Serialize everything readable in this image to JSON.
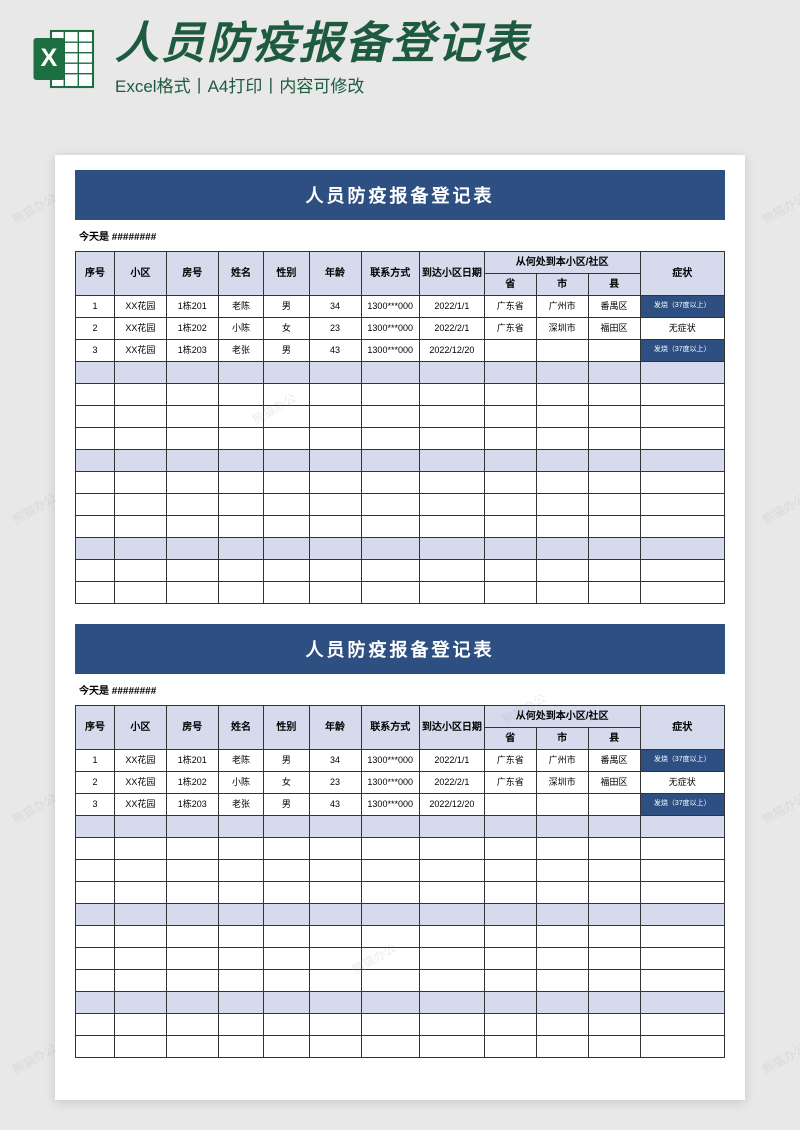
{
  "header": {
    "main_title": "人员防疫报备登记表",
    "sub_title": "Excel格式丨A4打印丨内容可修改"
  },
  "sheet": {
    "title": "人员防疫报备登记表",
    "date_label": "今天是",
    "date_value": "########",
    "columns": {
      "seq": "序号",
      "community": "小区",
      "room": "房号",
      "name": "姓名",
      "gender": "性别",
      "age": "年龄",
      "contact": "联系方式",
      "arrive_date": "到达小区日期",
      "origin_group": "从何处到本小区/社区",
      "province": "省",
      "city": "市",
      "county": "县",
      "symptom": "症状"
    },
    "rows": [
      {
        "seq": "1",
        "community": "XX花园",
        "room": "1栋201",
        "name": "老陈",
        "gender": "男",
        "age": "34",
        "contact": "1300***000",
        "arrive": "2022/1/1",
        "province": "广东省",
        "city": "广州市",
        "county": "番禺区",
        "symptom": "发烧（37度以上）",
        "fever": true
      },
      {
        "seq": "2",
        "community": "XX花园",
        "room": "1栋202",
        "name": "小陈",
        "gender": "女",
        "age": "23",
        "contact": "1300***000",
        "arrive": "2022/2/1",
        "province": "广东省",
        "city": "深圳市",
        "county": "福田区",
        "symptom": "无症状",
        "fever": false
      },
      {
        "seq": "3",
        "community": "XX花园",
        "room": "1栋203",
        "name": "老张",
        "gender": "男",
        "age": "43",
        "contact": "1300***000",
        "arrive": "2022/12/20",
        "province": "",
        "city": "",
        "county": "",
        "symptom": "发烧（37度以上）",
        "fever": true
      }
    ]
  },
  "watermark_text": "熊猫办公"
}
